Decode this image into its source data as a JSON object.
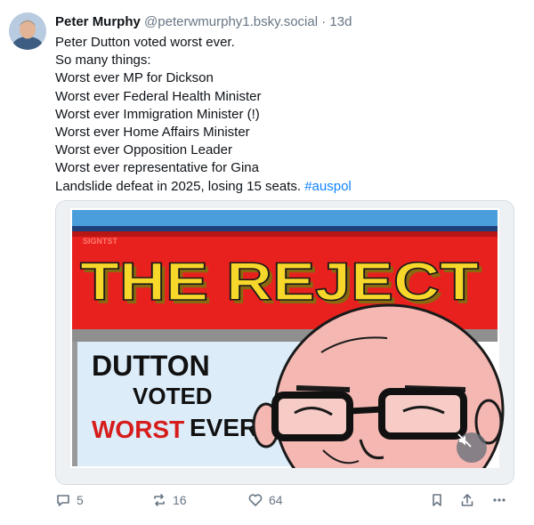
{
  "post": {
    "author_name": "Peter Murphy",
    "author_handle": "@peterwmurphy1.bsky.social",
    "separator": "·",
    "time": "13d",
    "lines": [
      "Peter Dutton voted worst ever.",
      "So many things:",
      "Worst ever MP for Dickson",
      "Worst ever Federal Health Minister",
      "Worst ever Immigration Minister (!)",
      "Worst ever Home Affairs Minister",
      "Worst ever Opposition Leader",
      "Worst ever representative for Gina"
    ],
    "last_line_text": "Landslide defeat in 2025, losing 15 seats.",
    "hashtag": "#auspol"
  },
  "media": {
    "banner_text": "THE REJECT",
    "watermark": "SIGNTST",
    "sign_line1": "DUTTON",
    "sign_line2": "VOTED",
    "sign_word_red": "WORST",
    "sign_word_black": "EVER",
    "mute_icon": "speaker-muted-icon"
  },
  "actions": {
    "reply_count": "5",
    "repost_count": "16",
    "like_count": "64"
  },
  "colors": {
    "hashtag": "#1083fe",
    "muted_text": "#687684",
    "banner_red": "#e8211e",
    "banner_yellow": "#f7d72a"
  }
}
